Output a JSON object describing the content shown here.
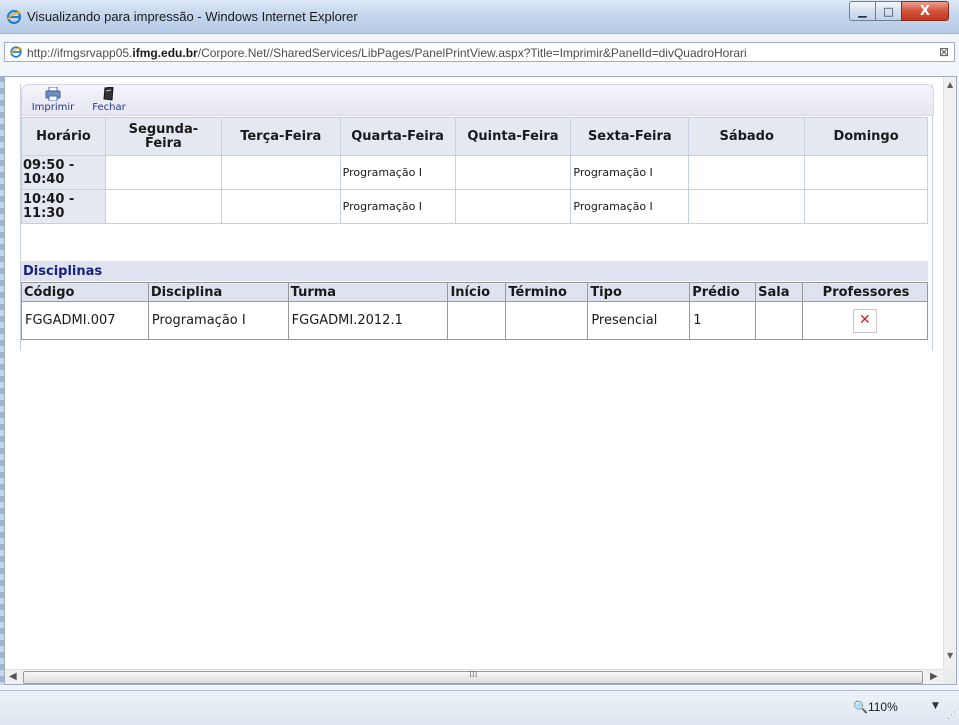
{
  "window": {
    "title": "Visualizando para impressão - Windows Internet Explorer",
    "min": "▁",
    "max": "□",
    "close": "X"
  },
  "address": {
    "url_prefix": "http://ifmgsrvapp05.",
    "url_domain": "ifmg.edu.br",
    "url_rest": "/Corpore.Net//SharedServices/LibPages/PanelPrintView.aspx?Title=Imprimir&PanelId=divQuadroHorari"
  },
  "toolbar": {
    "print_label": "Imprimir",
    "close_label": "Fechar"
  },
  "schedule": {
    "headers": [
      "Horário",
      "Segunda-Feira",
      "Terça-Feira",
      "Quarta-Feira",
      "Quinta-Feira",
      "Sexta-Feira",
      "Sábado",
      "Domingo"
    ],
    "rows": [
      {
        "time": "09:50 - 10:40",
        "cells": [
          "",
          "",
          "Programação I",
          "",
          "Programação I",
          "",
          ""
        ]
      },
      {
        "time": "10:40 - 11:30",
        "cells": [
          "",
          "",
          "Programação I",
          "",
          "Programação I",
          "",
          ""
        ]
      }
    ]
  },
  "disciplinas": {
    "title": "Disciplinas",
    "headers": [
      "Código",
      "Disciplina",
      "Turma",
      "Início",
      "Término",
      "Tipo",
      "Prédio",
      "Sala",
      "Professores"
    ],
    "rows": [
      {
        "codigo": "FGGADMI.007",
        "disciplina": "Programação I",
        "turma": "FGGADMI.2012.1",
        "inicio": "",
        "termino": "",
        "tipo": "Presencial",
        "predio": "1",
        "sala": "",
        "professores_icon": "broken-image-icon"
      }
    ]
  },
  "statusbar": {
    "zoom": "110%"
  },
  "colors": {
    "header_bg": "#e3e8f1",
    "title_accent": "#1a237e"
  }
}
